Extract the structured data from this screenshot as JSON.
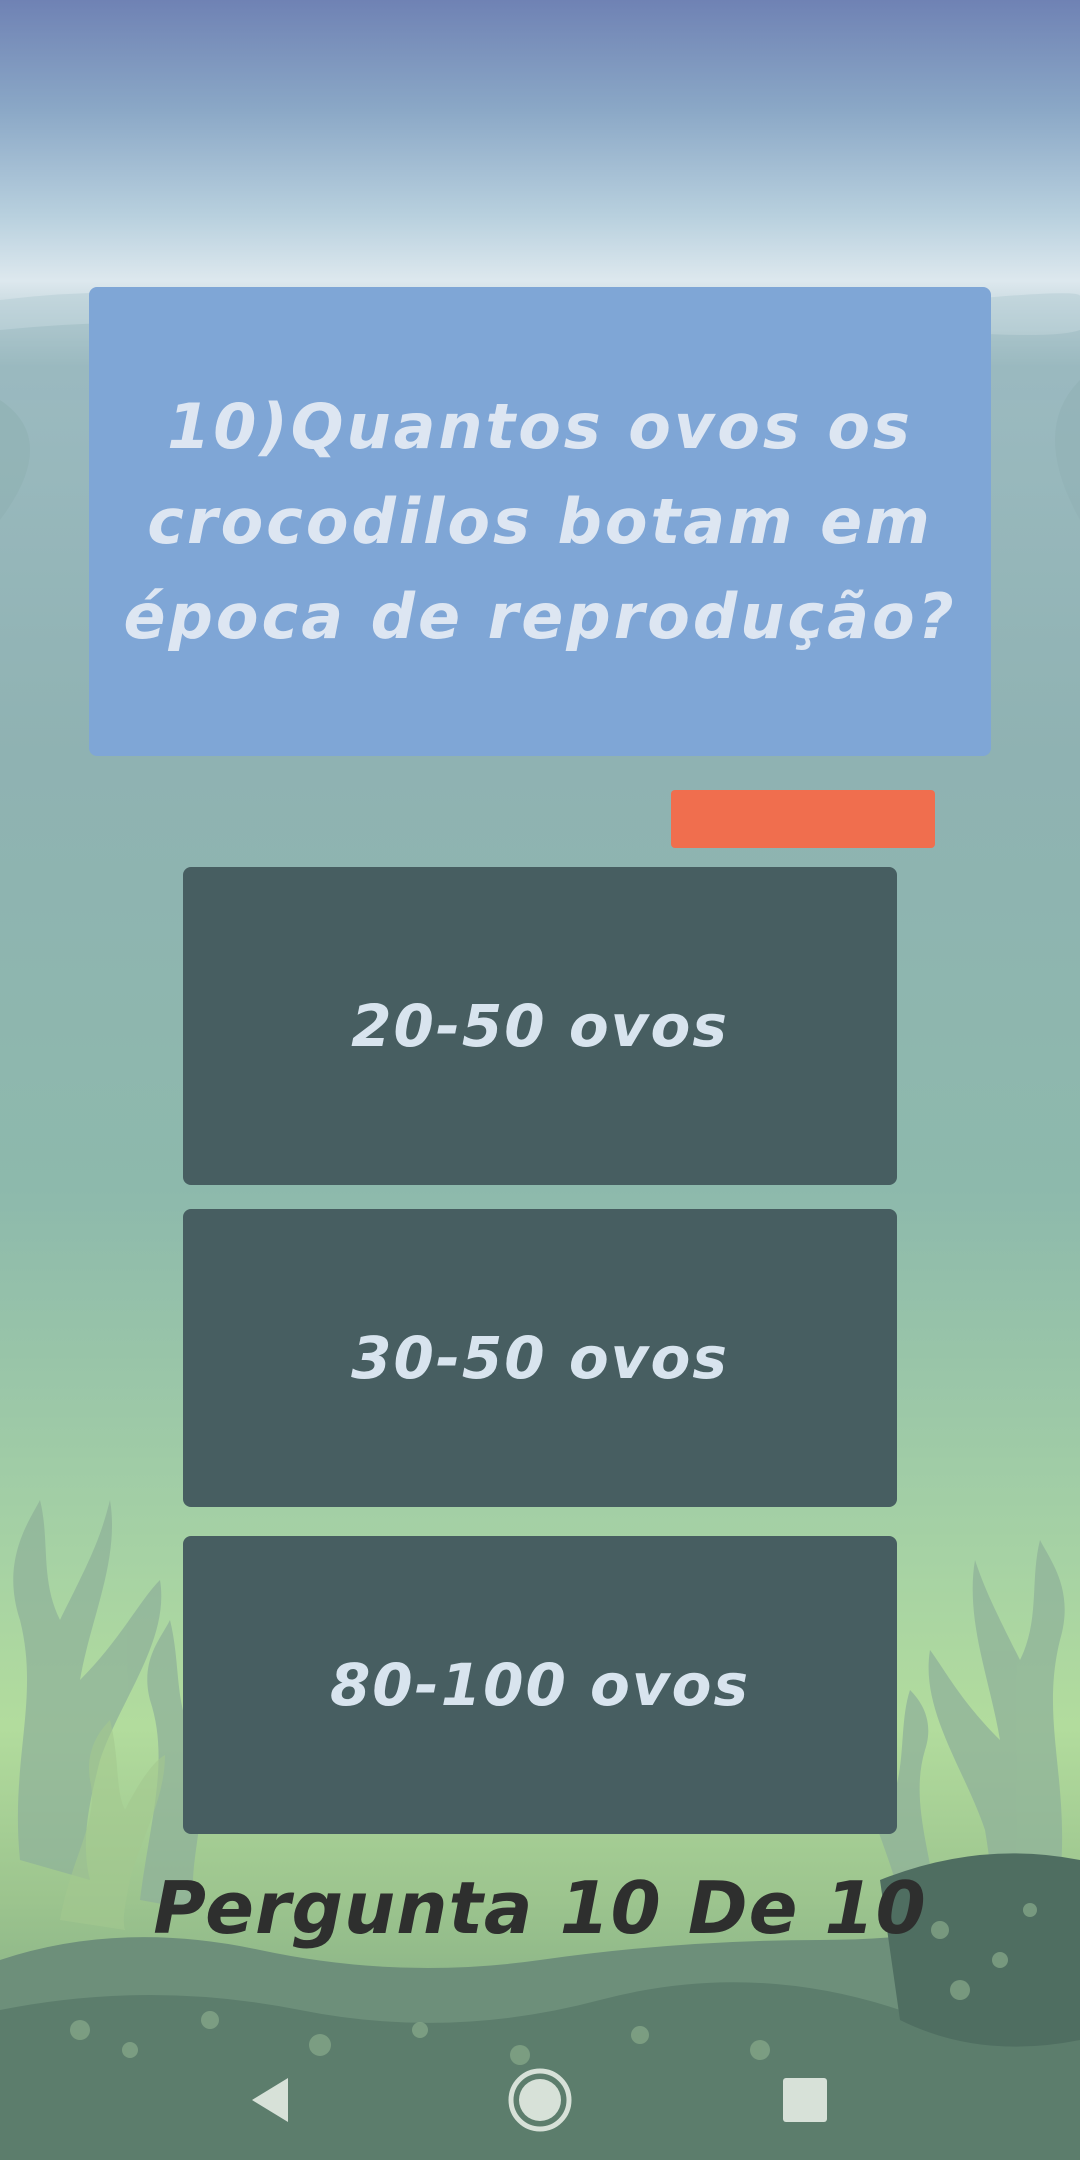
{
  "question": {
    "text": "10)Quantos ovos os crocodilos botam em época de reprodução?"
  },
  "answers": [
    {
      "label": "20-50 ovos"
    },
    {
      "label": "30-50 ovos"
    },
    {
      "label": "80-100 ovos"
    }
  ],
  "progress": {
    "text": "Pergunta 10 De 10"
  },
  "colors": {
    "question_box": "#7fa6d6",
    "answer_button": "#475e61",
    "timer_bar": "#f06e4e",
    "progress_text": "#2e2f2e"
  },
  "navbar": {
    "back_icon": "back-triangle-icon",
    "home_icon": "home-circle-icon",
    "recents_icon": "recents-square-icon"
  }
}
